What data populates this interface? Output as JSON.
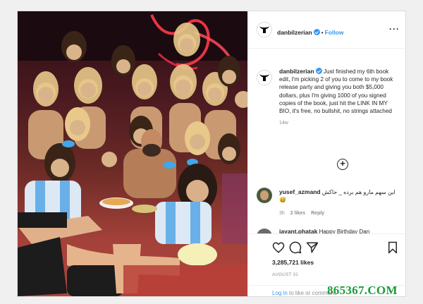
{
  "post": {
    "username": "danbilzerian",
    "follow_label": "Follow",
    "header_separator": "•",
    "more_label": "···",
    "caption": {
      "username": "danbilzerian",
      "text": "Just finished my 6th book edit, I'm picking 2 of you to come to my book release party and giving you both $5,000 dollars, plus I'm giving 1000 of you signed copies of the book, just hit the LINK IN MY BIO, it's free, no bullshit, no strings attached",
      "time": "14w"
    },
    "load_more_symbol": "+",
    "comments": [
      {
        "username": "yusef_azmand",
        "text": "این سهم مارو هم برده _ حاکش😅",
        "time": "3h",
        "likes": "2 likes",
        "reply_label": "Reply"
      },
      {
        "username": "jayant.phatak",
        "text": "Happy Birthday Dan"
      }
    ],
    "likes": "3,285,721 likes",
    "date": "AUGUST 31",
    "login": {
      "link": "Log in",
      "rest": "to like or comment."
    },
    "colors": {
      "link_blue": "#3897f0",
      "text": "#262626",
      "muted": "#8e8e8e",
      "border": "#dbdbdb"
    },
    "icons": [
      "heart-icon",
      "comment-icon",
      "share-icon",
      "bookmark-icon",
      "verified-badge-icon",
      "bull-logo-icon",
      "add-comment-icon"
    ]
  },
  "watermark": "865367.COM"
}
